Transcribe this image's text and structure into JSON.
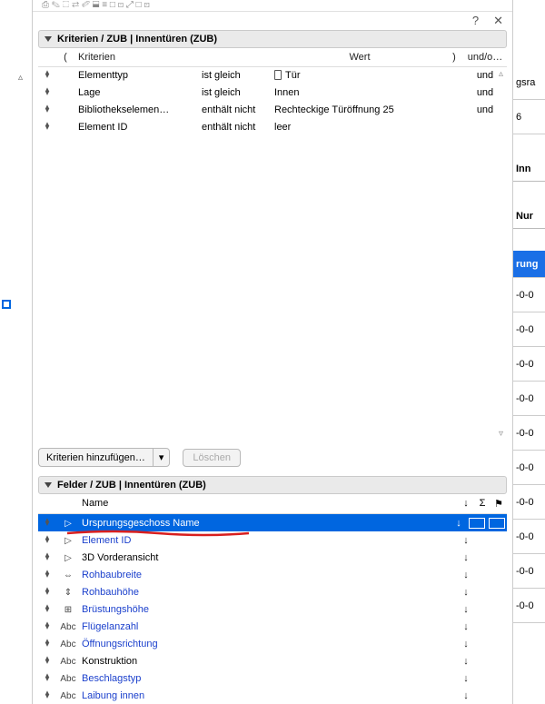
{
  "titlebar": {
    "help": "?",
    "close": "✕"
  },
  "criteria_section": {
    "title": "Kriterien / ZUB | Innentüren (ZUB)",
    "headers": {
      "paren_open": "(",
      "criteria": "Kriterien",
      "value": "Wert",
      "paren_close": ")",
      "andor": "und/o…"
    },
    "rows": [
      {
        "criterion": "Elementtyp",
        "op": "ist gleich",
        "value": "Tür",
        "hasDoorIcon": true,
        "andor": "und"
      },
      {
        "criterion": "Lage",
        "op": "ist gleich",
        "value": "Innen",
        "hasDoorIcon": false,
        "andor": "und"
      },
      {
        "criterion": "Bibliothekselemen…",
        "op": "enthält nicht",
        "value": "Rechteckige Türöffnung 25",
        "hasDoorIcon": false,
        "andor": "und"
      },
      {
        "criterion": "Element ID",
        "op": "enthält nicht",
        "value": "leer",
        "hasDoorIcon": false,
        "andor": ""
      }
    ],
    "add_button": "Kriterien hinzufügen…",
    "delete_button": "Löschen"
  },
  "fields_section": {
    "title": "Felder / ZUB | Innentüren (ZUB)",
    "headers": {
      "name": "Name",
      "sort": "↓",
      "sum": "Σ",
      "flag": "⚑"
    },
    "rows": [
      {
        "name": "Ursprungsgeschoss Name",
        "icon": "▷",
        "selected": true,
        "sortable": true,
        "showBoxes": true,
        "underline": true
      },
      {
        "name": "Element ID",
        "icon": "▷",
        "selected": false,
        "sortable": true,
        "color": "blue"
      },
      {
        "name": "3D Vorderansicht",
        "icon": "▷",
        "selected": false,
        "sortable": true,
        "color": "black"
      },
      {
        "name": "Rohbaubreite",
        "icon": "⇔",
        "selected": false,
        "sortable": true,
        "color": "blue"
      },
      {
        "name": "Rohbauhöhe",
        "icon": "⇕",
        "selected": false,
        "sortable": true,
        "color": "blue"
      },
      {
        "name": "Brüstungshöhe",
        "icon": "⊞",
        "selected": false,
        "sortable": true,
        "color": "blue"
      },
      {
        "name": "Flügelanzahl",
        "icon": "Abc",
        "selected": false,
        "sortable": true,
        "color": "blue"
      },
      {
        "name": "Öffnungsrichtung",
        "icon": "Abc",
        "selected": false,
        "sortable": true,
        "color": "blue"
      },
      {
        "name": "Konstruktion",
        "icon": "Abc",
        "selected": false,
        "sortable": true,
        "color": "black"
      },
      {
        "name": "Beschlagstyp",
        "icon": "Abc",
        "selected": false,
        "sortable": true,
        "color": "blue"
      },
      {
        "name": "Laibung innen",
        "icon": "Abc",
        "selected": false,
        "sortable": true,
        "color": "blue"
      }
    ]
  },
  "right_strip": {
    "items": [
      {
        "text": "gsra",
        "type": "cell"
      },
      {
        "text": "6",
        "type": "cell"
      },
      {
        "text": "",
        "type": "spacer"
      },
      {
        "text": "Inn",
        "type": "hdr"
      },
      {
        "text": "",
        "type": "spacer"
      },
      {
        "text": "Nur",
        "type": "hdr"
      },
      {
        "text": "",
        "type": "spacer"
      },
      {
        "text": "rung",
        "type": "blue"
      },
      {
        "text": "-0-0",
        "type": "cell"
      },
      {
        "text": "-0-0",
        "type": "cell"
      },
      {
        "text": "-0-0",
        "type": "cell"
      },
      {
        "text": "-0-0",
        "type": "cell"
      },
      {
        "text": "-0-0",
        "type": "cell"
      },
      {
        "text": "-0-0",
        "type": "cell"
      },
      {
        "text": "-0-0",
        "type": "cell"
      },
      {
        "text": "-0-0",
        "type": "cell"
      },
      {
        "text": "-0-0",
        "type": "cell"
      },
      {
        "text": "-0-0",
        "type": "cell"
      }
    ]
  }
}
